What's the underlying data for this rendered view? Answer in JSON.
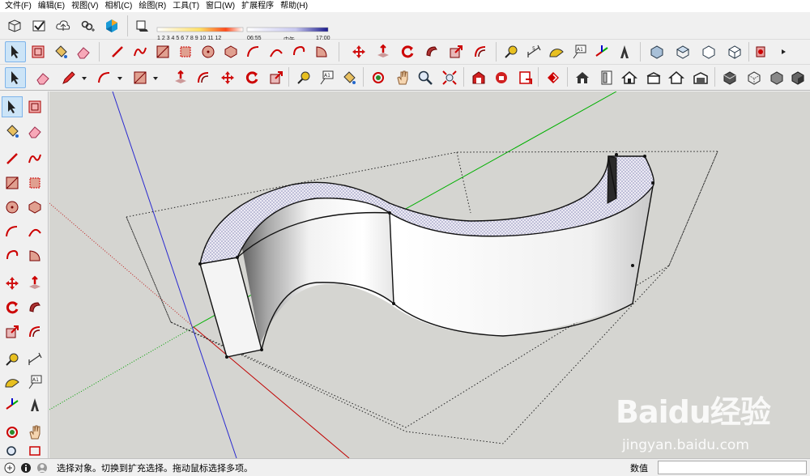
{
  "menu": [
    "文件(F)",
    "编辑(E)",
    "视图(V)",
    "相机(C)",
    "绘图(R)",
    "工具(T)",
    "窗口(W)",
    "扩展程序",
    "帮助(H)"
  ],
  "shadow": {
    "month_scale": "1 2 3 4 5 6 7 8 9 10 11 12",
    "time_start": "06:55",
    "time_mid": "中午",
    "time_end": "17:00"
  },
  "toolbar_icons": {
    "row1": [
      "component-icon",
      "check-icon",
      "cloud-upload-icon",
      "link-add-icon",
      "trimble-logo-icon",
      "shadow-toggle-icon"
    ],
    "row2": [
      "select-icon",
      "make-component-icon",
      "paint-bucket-icon",
      "eraser-icon",
      "line-icon",
      "freehand-icon",
      "rectangle-icon",
      "rotated-rectangle-icon",
      "circle-icon",
      "polygon-icon",
      "arc-icon",
      "two-point-arc-icon",
      "three-point-arc-icon",
      "pie-icon",
      "move-icon",
      "push-pull-icon",
      "rotate-icon",
      "follow-me-icon",
      "scale-icon",
      "offset-icon",
      "tape-measure-icon",
      "dimension-icon",
      "protractor-icon",
      "text-icon",
      "axes-icon",
      "3d-text-icon",
      "iso-view-icon",
      "top-view-icon",
      "front-view-icon",
      "right-view-icon",
      "section-plane-icon",
      "more-icon"
    ],
    "row3": [
      "select-icon",
      "eraser-icon",
      "pencil-icon",
      "arc-icon",
      "shape-icon",
      "push-pull-icon",
      "offset-icon",
      "move-icon",
      "rotate-icon",
      "scale-icon",
      "tape-measure-icon",
      "text-icon",
      "paint-bucket-icon",
      "orbit-icon",
      "pan-icon",
      "zoom-icon",
      "zoom-extents-icon",
      "warehouse-icon",
      "extension-warehouse-icon",
      "layout-icon",
      "extension-icon",
      "house-icon",
      "door-icon",
      "house-outline-icon",
      "house-flat-icon",
      "house-alt-icon",
      "garage-icon",
      "style-icon",
      "xray-icon",
      "hidden-line-icon",
      "shaded-icon",
      "shaded-texture-icon"
    ]
  },
  "status": {
    "text": "选择对象。切换到扩充选择。拖动鼠标选择多项。",
    "measure_label": "数值",
    "measure_value": ""
  },
  "watermark": {
    "brand": "Baidu经验",
    "url": "jingyan.baidu.com"
  },
  "colors": {
    "viewport_bg": "#d5d5d1",
    "axis_red": "#c00000",
    "axis_green": "#00a000",
    "axis_blue": "#0000c0",
    "face_top": "#b8b8d8",
    "face_side": "#f4f4f4"
  }
}
